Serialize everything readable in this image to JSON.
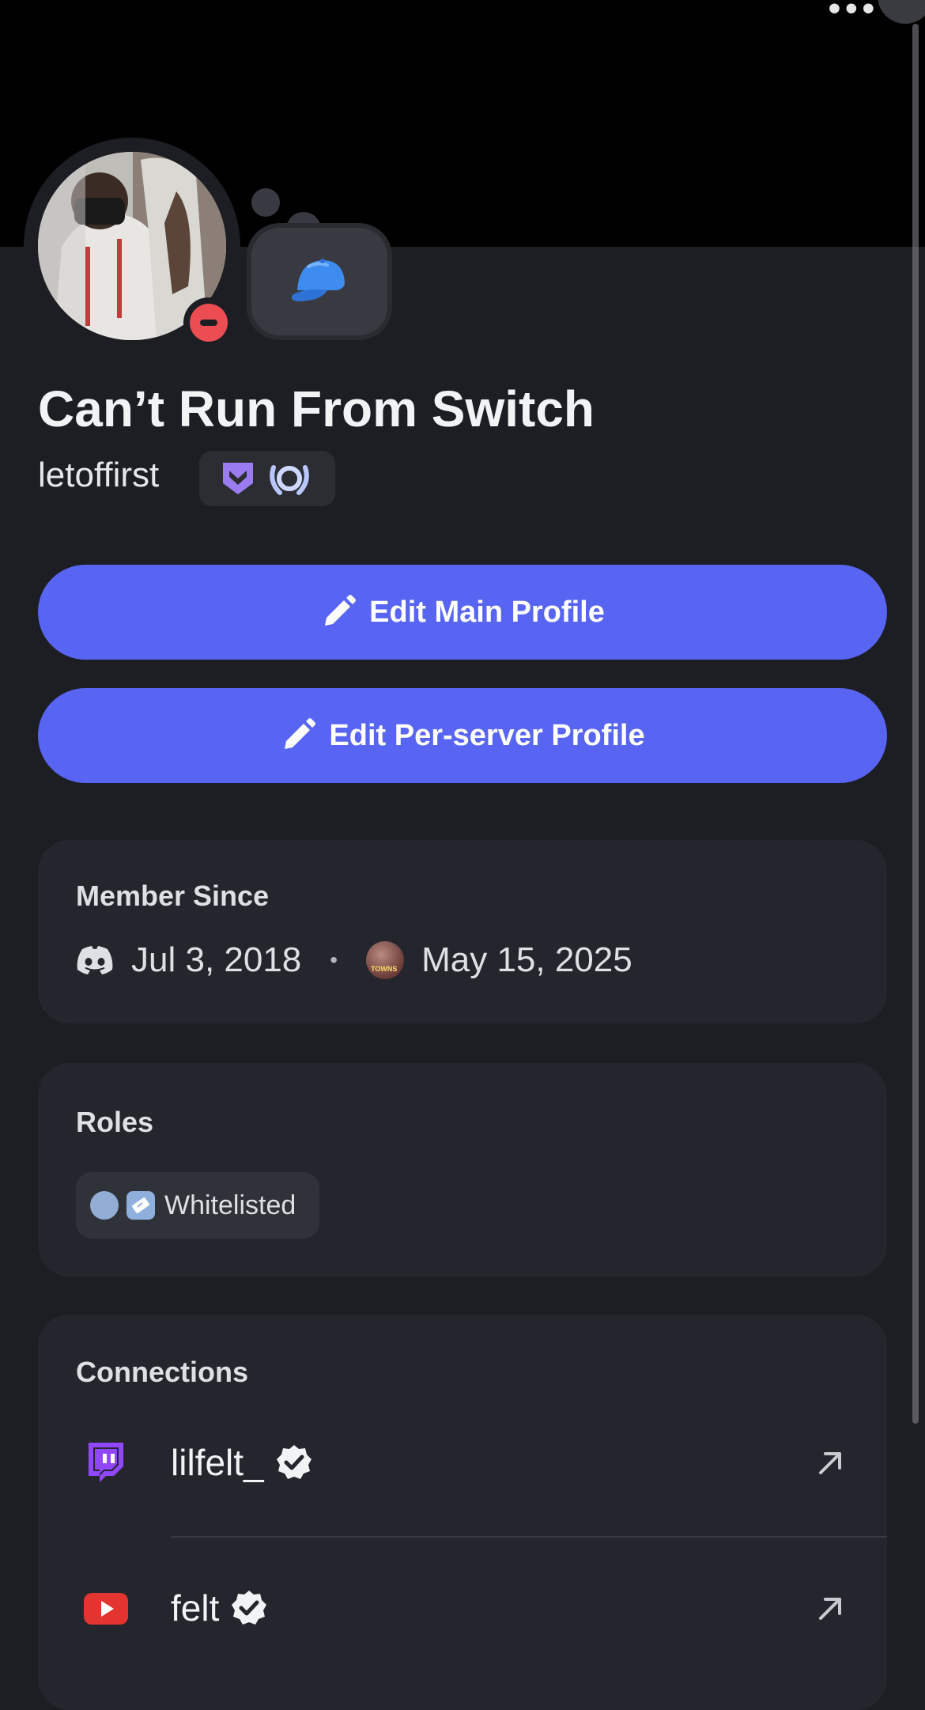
{
  "profile": {
    "display_name": "Can’t Run From Switch",
    "username": "letoffirst",
    "status": "do-not-disturb",
    "custom_status_emoji": "cap-icon",
    "badges": [
      "nitro-badge-icon",
      "hypesquad-laurel-icon"
    ]
  },
  "actions": {
    "edit_main": "Edit Main Profile",
    "edit_server": "Edit Per-server Profile"
  },
  "member_since": {
    "title": "Member Since",
    "discord_date": "Jul 3, 2018",
    "separator": "•",
    "server_date": "May 15, 2025",
    "server_icon_text": "TOWNS"
  },
  "roles": {
    "title": "Roles",
    "items": [
      {
        "label": "Whitelisted",
        "color": "#92aed4"
      }
    ]
  },
  "connections": {
    "title": "Connections",
    "items": [
      {
        "platform": "twitch",
        "name": "lilfelt_",
        "verified": true
      },
      {
        "platform": "youtube",
        "name": "felt",
        "verified": true
      }
    ]
  },
  "colors": {
    "blurple": "#5865f2",
    "background": "#1d1e23",
    "card": "#25262d",
    "dnd_red": "#ec4d52",
    "twitch": "#9146ff",
    "youtube": "#e3342f"
  }
}
